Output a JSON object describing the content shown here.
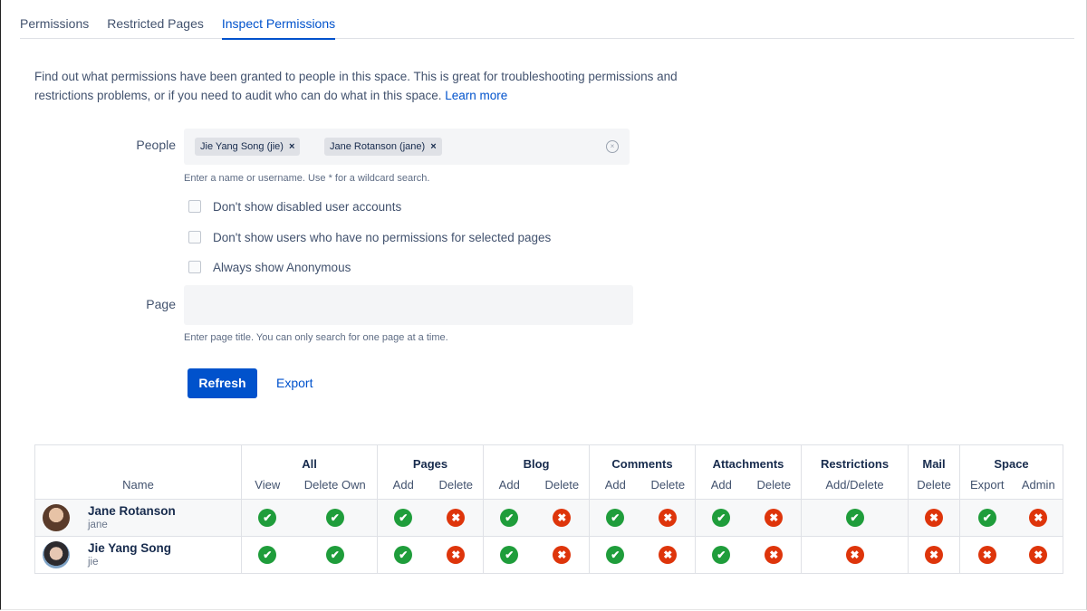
{
  "tabs": [
    {
      "label": "Permissions",
      "active": false
    },
    {
      "label": "Restricted Pages",
      "active": false
    },
    {
      "label": "Inspect Permissions",
      "active": true
    }
  ],
  "intro": {
    "text": "Find out what permissions have been granted to people in this space. This is great for troubleshooting permissions and restrictions problems, or if you need to audit who can do what in this space.",
    "link": "Learn more"
  },
  "form": {
    "people_label": "People",
    "people_chips": [
      "Jie Yang Song (jie)",
      "Jane Rotanson (jane)"
    ],
    "people_help": "Enter a name or username. Use * for a wildcard search.",
    "checkboxes": [
      {
        "label": "Don't show disabled user accounts",
        "checked": false
      },
      {
        "label": "Don't show users who have no permissions for selected pages",
        "checked": false
      },
      {
        "label": "Always show Anonymous",
        "checked": false
      }
    ],
    "page_label": "Page",
    "page_value": "",
    "page_help": "Enter page title. You can only search for one page at a time.",
    "refresh_label": "Refresh",
    "export_label": "Export"
  },
  "table": {
    "name_header": "Name",
    "groups": [
      "All",
      "Pages",
      "Blog",
      "Comments",
      "Attachments",
      "Restrictions",
      "Mail",
      "Space"
    ],
    "subheaders": [
      "View",
      "Delete Own",
      "Add",
      "Delete",
      "Add",
      "Delete",
      "Add",
      "Delete",
      "Add",
      "Delete",
      "Add/Delete",
      "Delete",
      "Export",
      "Admin"
    ],
    "users": [
      {
        "name": "Jane Rotanson",
        "username": "jane",
        "perms": [
          true,
          true,
          true,
          false,
          true,
          false,
          true,
          false,
          true,
          false,
          true,
          false,
          true,
          false
        ]
      },
      {
        "name": "Jie Yang Song",
        "username": "jie",
        "perms": [
          true,
          true,
          true,
          false,
          true,
          false,
          true,
          false,
          true,
          false,
          false,
          false,
          false,
          false
        ]
      }
    ]
  },
  "colors": {
    "accent": "#0052CC",
    "granted": "#1f9d3b",
    "denied": "#de350b"
  },
  "icons": {
    "granted": "check-circle-icon",
    "denied": "cross-circle-icon",
    "clear": "clear-icon",
    "remove": "remove-icon"
  }
}
